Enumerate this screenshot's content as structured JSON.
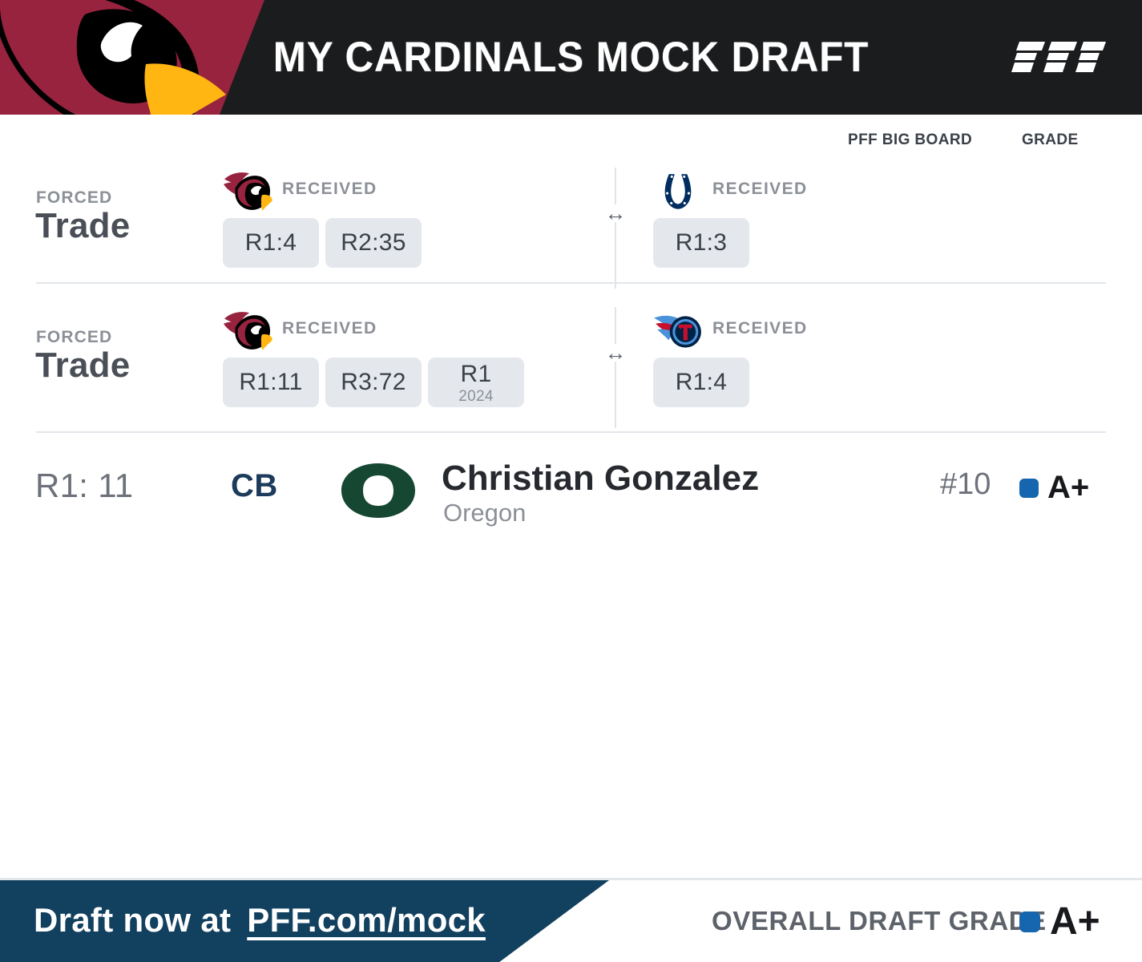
{
  "header": {
    "title": "MY CARDINALS MOCK DRAFT",
    "brand_logo": "pff-logo",
    "team_logo": "arizona-cardinals-logo",
    "background_color": "#1b1c1e",
    "team_panel_color": "#97233F"
  },
  "columns": {
    "big_board_label": "PFF BIG BOARD",
    "grade_label": "GRADE"
  },
  "trades": [
    {
      "kicker": "FORCED",
      "title": "Trade",
      "swap_icon": "swap-arrows-icon",
      "left": {
        "team_logo": "arizona-cardinals-logo",
        "received_label": "RECEIVED",
        "picks": [
          {
            "main": "R1:4",
            "sub": ""
          },
          {
            "main": "R2:35",
            "sub": ""
          }
        ]
      },
      "right": {
        "team_logo": "indianapolis-colts-logo",
        "received_label": "RECEIVED",
        "picks": [
          {
            "main": "R1:3",
            "sub": ""
          }
        ]
      }
    },
    {
      "kicker": "FORCED",
      "title": "Trade",
      "swap_icon": "swap-arrows-icon",
      "left": {
        "team_logo": "arizona-cardinals-logo",
        "received_label": "RECEIVED",
        "picks": [
          {
            "main": "R1:11",
            "sub": ""
          },
          {
            "main": "R3:72",
            "sub": ""
          },
          {
            "main": "R1",
            "sub": "2024"
          }
        ]
      },
      "right": {
        "team_logo": "tennessee-titans-logo",
        "received_label": "RECEIVED",
        "picks": [
          {
            "main": "R1:4",
            "sub": ""
          }
        ]
      }
    }
  ],
  "picks": [
    {
      "slot": "R1: 11",
      "position": "CB",
      "school_logo": "oregon-ducks-logo",
      "player": "Christian Gonzalez",
      "school": "Oregon",
      "big_board": "#10",
      "grade": "A+",
      "grade_color": "#1566ae"
    }
  ],
  "footer": {
    "cta_text": "Draft now at",
    "url": "PFF.com/mock",
    "overall_label": "OVERALL DRAFT GRADE",
    "overall_grade": "A+",
    "overall_grade_color": "#1566ae",
    "panel_color": "#12405F"
  }
}
